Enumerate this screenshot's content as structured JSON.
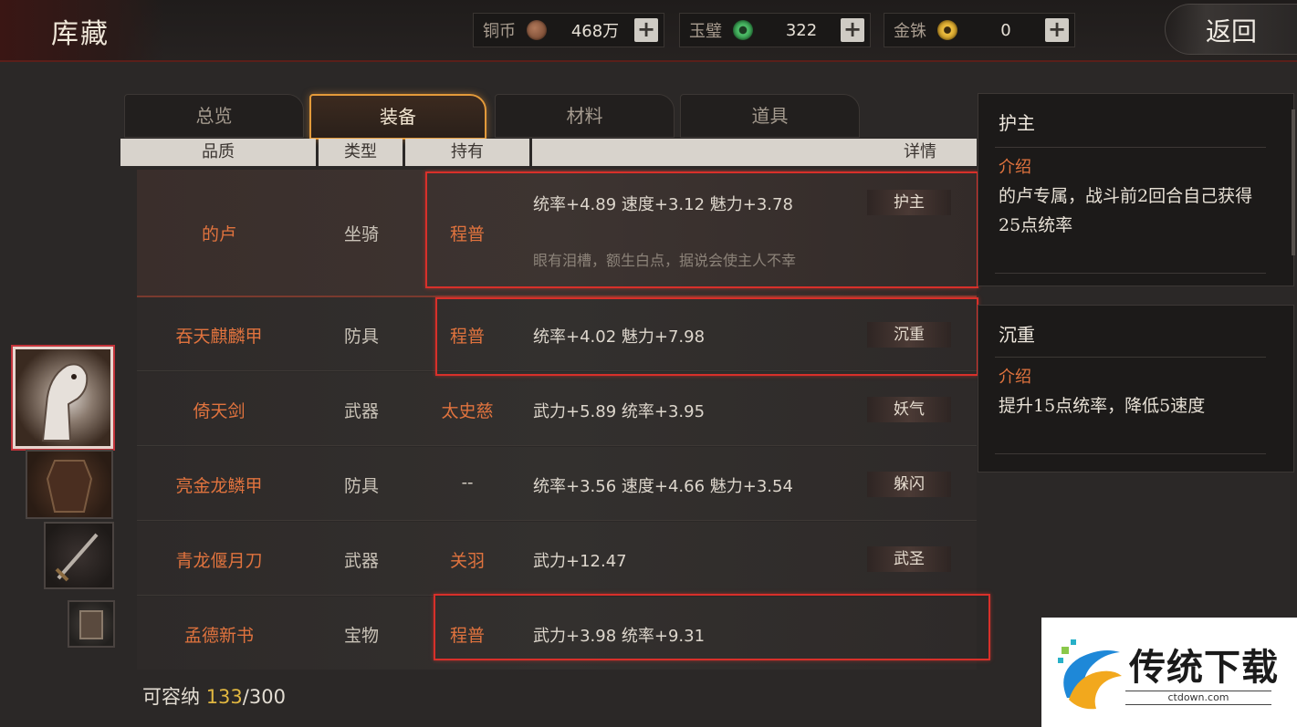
{
  "header": {
    "title": "库藏",
    "back_label": "返回"
  },
  "resources": [
    {
      "label": "铜币",
      "value": "468万",
      "icon": "copper-coin-icon",
      "color": "#8a5a3a"
    },
    {
      "label": "玉璧",
      "value": "322",
      "icon": "jade-disc-icon",
      "color": "#3aa35a"
    },
    {
      "label": "金铢",
      "value": "0",
      "icon": "gold-coin-icon",
      "color": "#d9a531"
    }
  ],
  "tabs": [
    {
      "label": "总览",
      "active": false
    },
    {
      "label": "装备",
      "active": true
    },
    {
      "label": "材料",
      "active": false
    },
    {
      "label": "道具",
      "active": false
    }
  ],
  "columns": [
    "品质",
    "类型",
    "持有",
    "详情"
  ],
  "items": [
    {
      "name": "的卢",
      "type": "坐骑",
      "owner": "程普",
      "attrs": "统率+4.89  速度+3.12  魅力+3.78",
      "desc": "眼有泪槽，额生白点，据说会使主人不幸",
      "tag": "护主",
      "selected": true
    },
    {
      "name": "吞天麒麟甲",
      "type": "防具",
      "owner": "程普",
      "attrs": "统率+4.02  魅力+7.98",
      "tag": "沉重",
      "selected": false
    },
    {
      "name": "倚天剑",
      "type": "武器",
      "owner": "太史慈",
      "attrs": "武力+5.89  统率+3.95",
      "tag": "妖气",
      "selected": false
    },
    {
      "name": "亮金龙鳞甲",
      "type": "防具",
      "owner": "--",
      "attrs": "统率+3.56  速度+4.66  魅力+3.54",
      "tag": "躲闪",
      "selected": false
    },
    {
      "name": "青龙偃月刀",
      "type": "武器",
      "owner": "关羽",
      "attrs": "武力+12.47",
      "tag": "武圣",
      "selected": false
    },
    {
      "name": "孟德新书",
      "type": "宝物",
      "owner": "程普",
      "attrs": "武力+3.98  统率+9.31",
      "tag": "",
      "selected": false
    }
  ],
  "tooltips": [
    {
      "title": "护主",
      "label": "介绍",
      "text": "的卢专属，战斗前2回合自己获得25点统率"
    },
    {
      "title": "沉重",
      "label": "介绍",
      "text": "提升15点统率，降低5速度"
    }
  ],
  "capacity": {
    "label": "可容纳",
    "current": "133",
    "max": "/300"
  },
  "watermark": {
    "brand": "传统下载",
    "url": "ctdown.com"
  },
  "colors": {
    "accent_orange": "#e0733e",
    "tab_glow": "#e39a3a",
    "highlight_red": "#d8302a",
    "capacity_yellow": "#e1b740"
  }
}
